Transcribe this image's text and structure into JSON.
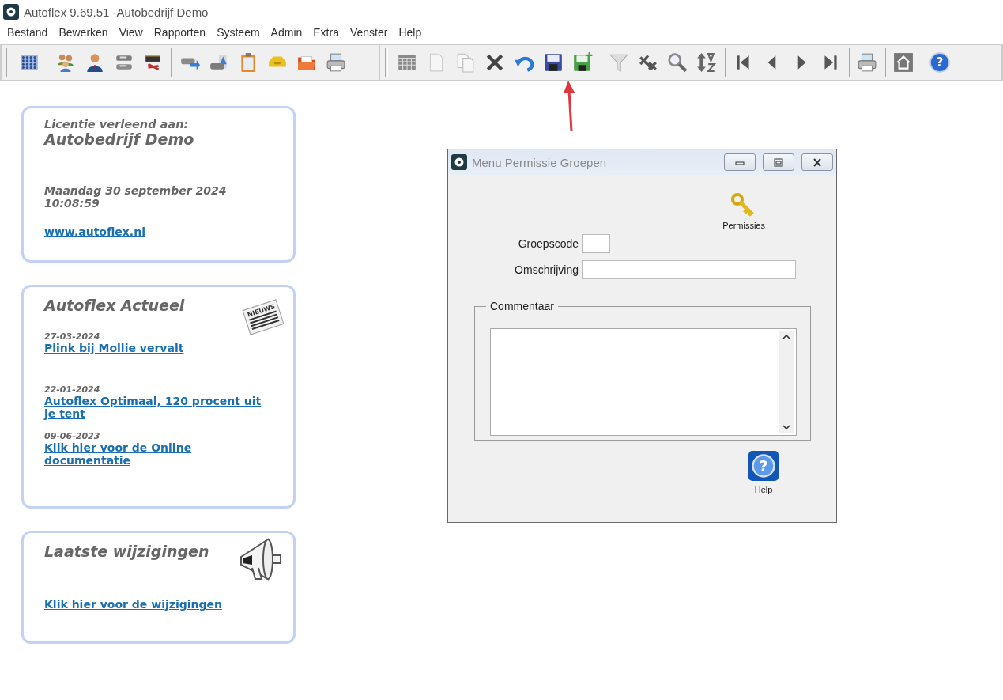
{
  "window": {
    "title": "Autoflex 9.69.51 -Autobedrijf Demo"
  },
  "toolbar": {
    "help_glyph": "?"
  },
  "menu": [
    "Bestand",
    "Bewerken",
    "View",
    "Rapporten",
    "Systeem",
    "Admin",
    "Extra",
    "Venster",
    "Help"
  ],
  "license_card": {
    "label": "Licentie verleend aan:",
    "company": "Autobedrijf Demo",
    "date": "Maandag 30 september 2024",
    "time": "10:08:59",
    "link": "www.autoflex.nl"
  },
  "news_card": {
    "title": "Autoflex Actueel",
    "icon_text": "NIEUWS",
    "items": [
      {
        "date": "27-03-2024",
        "link": "Plink bij Mollie vervalt"
      },
      {
        "date": "22-01-2024",
        "link": "Autoflex Optimaal, 120 procent uit je tent"
      },
      {
        "date": "09-06-2023",
        "link": "Klik hier voor de Online documentatie"
      }
    ]
  },
  "changes_card": {
    "title": "Laatste wijzigingen",
    "link": "Klik hier voor de wijzigingen"
  },
  "dialog": {
    "title": "Menu Permissie Groepen",
    "permissions_button": "Permissies",
    "fields": [
      {
        "label": "Groepscode",
        "kind": "short"
      },
      {
        "label": "Omschrijving",
        "kind": "long"
      }
    ],
    "comment_group": "Commentaar",
    "help_glyph": "?",
    "help_button": "Help"
  }
}
